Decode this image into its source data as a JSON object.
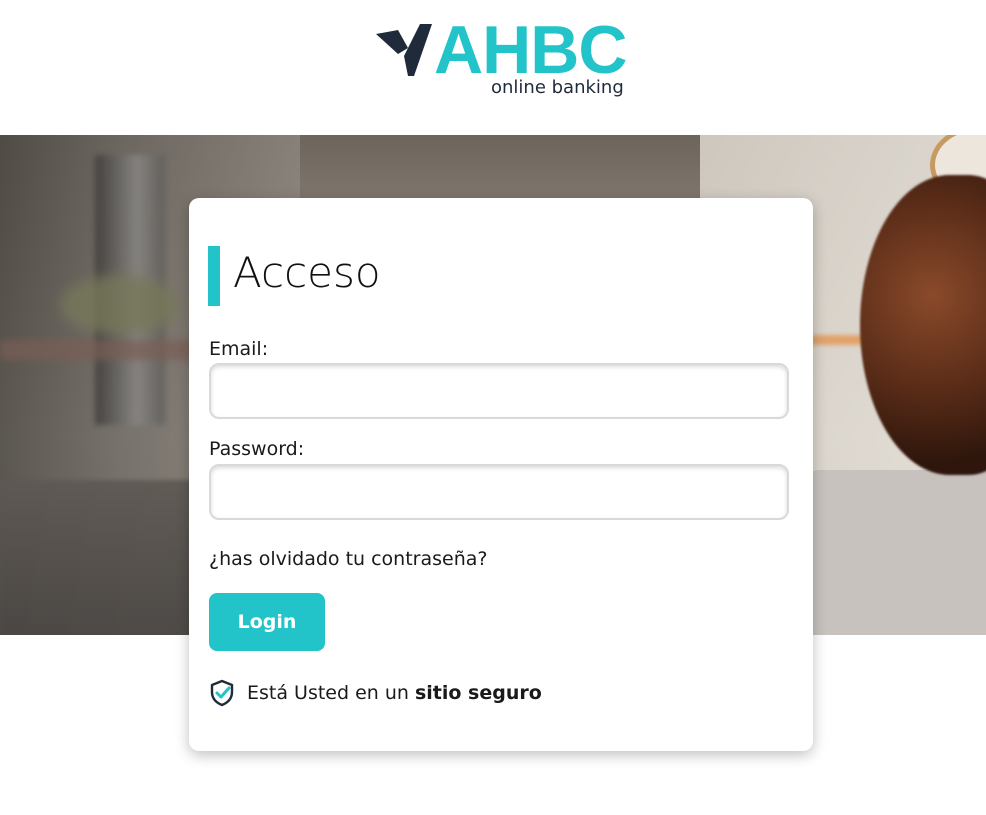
{
  "brand": {
    "name": "AHBC",
    "tagline": "online banking",
    "accent_color": "#22c3c9",
    "dark_color": "#1f2a3a"
  },
  "login": {
    "title": "Acceso",
    "email_label": "Email:",
    "email_value": "",
    "password_label": "Password:",
    "password_value": "",
    "forgot_link": "¿has olvidado tu contraseña?",
    "submit_label": "Login",
    "secure_text": "Está Usted en un",
    "secure_bold": "sitio seguro",
    "secure_icon": "shield-check-icon"
  }
}
